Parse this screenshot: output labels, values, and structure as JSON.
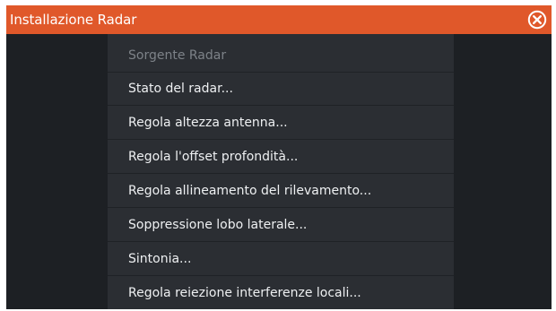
{
  "dialog": {
    "title": "Installazione Radar",
    "close_icon": "close-circle-icon"
  },
  "menu": {
    "items": [
      {
        "label": "Sorgente Radar",
        "enabled": false
      },
      {
        "label": "Stato del radar...",
        "enabled": true
      },
      {
        "label": "Regola altezza antenna...",
        "enabled": true
      },
      {
        "label": "Regola l'offset profondità...",
        "enabled": true
      },
      {
        "label": "Regola allineamento del rilevamento...",
        "enabled": true
      },
      {
        "label": "Soppressione lobo laterale...",
        "enabled": true
      },
      {
        "label": "Sintonia...",
        "enabled": true
      },
      {
        "label": "Regola reiezione interferenze locali...",
        "enabled": true
      }
    ]
  },
  "colors": {
    "titlebar": "#e0582a",
    "background": "#1d2024",
    "menu": "#2b2e33",
    "text": "#eef0f2",
    "disabled_text": "#7d8288"
  }
}
